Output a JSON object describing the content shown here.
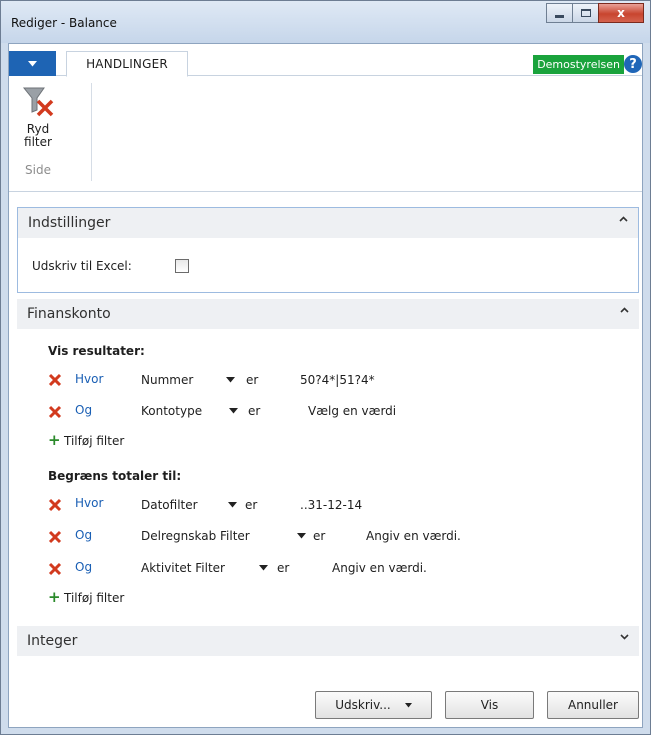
{
  "window": {
    "title": "Rediger - Balance",
    "controls": {
      "minimize": "",
      "maximize": "",
      "close": "x"
    }
  },
  "ribbon": {
    "app_menu_icon": "caret-down-icon",
    "tab_label": "HANDLINGER",
    "company": "Demostyrelsen",
    "help_label": "?",
    "clear_filter_line1": "Ryd",
    "clear_filter_line2": "filter",
    "group_label": "Side"
  },
  "settings": {
    "header": "Indstillinger",
    "excel_label": "Udskriv til Excel:",
    "excel_checked": false
  },
  "account": {
    "header": "Finanskonto",
    "show_results_label": "Vis resultater:",
    "results_filters": [
      {
        "conj": "Hvor",
        "field": "Nummer",
        "op": "er",
        "value": "50?4*|51?4*"
      },
      {
        "conj": "Og",
        "field": "Kontotype",
        "op": "er",
        "value": "Vælg en værdi"
      }
    ],
    "add_filter_label": "Tilføj filter",
    "limit_totals_label": "Begræns totaler til:",
    "totals_filters": [
      {
        "conj": "Hvor",
        "field": "Datofilter",
        "op": "er",
        "value": "..31-12-14"
      },
      {
        "conj": "Og",
        "field": "Delregnskab Filter",
        "op": "er",
        "value": "Angiv en værdi."
      },
      {
        "conj": "Og",
        "field": "Aktivitet Filter",
        "op": "er",
        "value": "Angiv en værdi."
      }
    ],
    "add_filter_label2": "Tilføj filter"
  },
  "integer": {
    "header": "Integer"
  },
  "footer": {
    "print_label": "Udskriv...",
    "show_label": "Vis",
    "cancel_label": "Annuller"
  },
  "colors": {
    "accent": "#1e64b4",
    "company_badge": "#1aa33c",
    "remove_icon": "#d23a1e",
    "link": "#1a5fb4"
  }
}
